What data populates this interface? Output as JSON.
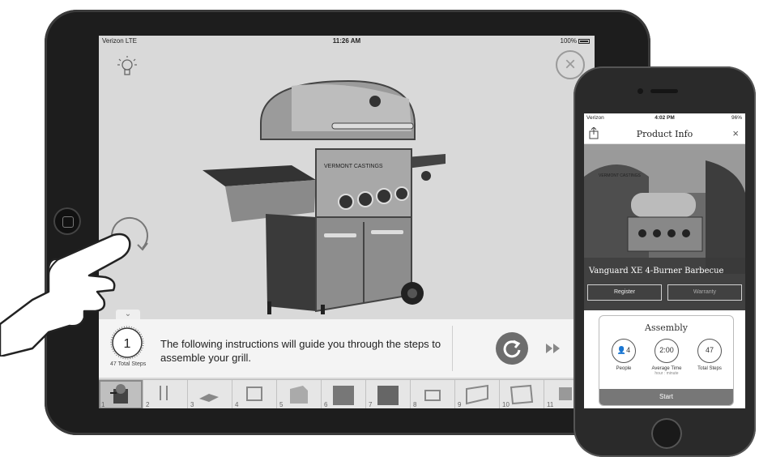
{
  "ipad": {
    "status": {
      "carrier": "Verizon  LTE",
      "time": "11:26 AM",
      "battery": "100%"
    },
    "instructions": {
      "step_number": "1",
      "total_steps_text": "47 Total Steps",
      "text": "The following instructions will guide you through the steps to assemble your grill."
    },
    "grill_brand": "VERMONT CASTINGS",
    "thumbnails": [
      "1",
      "2",
      "3",
      "4",
      "5",
      "6",
      "7",
      "8",
      "9",
      "10",
      "11"
    ],
    "icons": {
      "bulb": "lightbulb-icon",
      "close": "close-icon",
      "rotate": "rotate-icon",
      "replay": "replay-icon",
      "fast_forward": "fast-forward-icon",
      "collapse": "chevron-down-icon"
    }
  },
  "iphone": {
    "status": {
      "carrier": "Verizon",
      "time": "4:02 PM",
      "battery": "96%"
    },
    "header": {
      "title": "Product Info",
      "close": "×"
    },
    "hero": {
      "brand": "VERMONT CASTINGS",
      "product_name": "Vanguard XE 4-Burner Barbecue",
      "register_label": "Register",
      "warranty_label": "Warranty"
    },
    "assembly": {
      "title": "Assembly",
      "people_value": "4",
      "people_label": "People",
      "time_value": "2:00",
      "time_label": "Average Time",
      "time_sub": "hour : minute",
      "steps_value": "47",
      "steps_label": "Total Steps",
      "start_label": "Start"
    }
  }
}
